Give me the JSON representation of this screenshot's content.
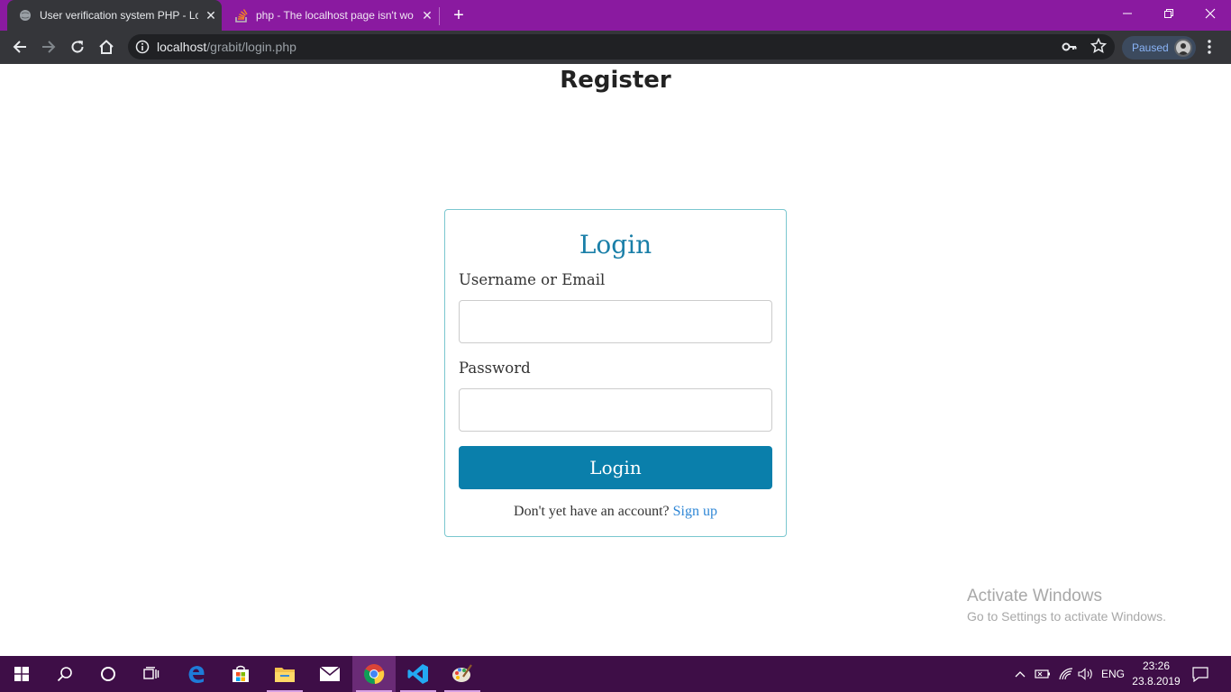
{
  "browser": {
    "tabs": [
      {
        "title": "User verification system PHP - Lo",
        "active": true
      },
      {
        "title": "php - The localhost page isn't wo",
        "active": false
      }
    ],
    "url_host": "localhost",
    "url_path": "/grabit/login.php",
    "profile_label": "Paused",
    "accent_color": "#8a1aa0"
  },
  "page": {
    "heading": "Register",
    "login_form": {
      "title": "Login",
      "username_label": "Username or Email",
      "username_value": "",
      "password_label": "Password",
      "password_value": "",
      "submit_label": "Login",
      "signup_prompt": "Don't yet have an account?",
      "signup_link": "Sign up",
      "primary_color": "#0a7fab"
    },
    "watermark": {
      "line1": "Activate Windows",
      "line2": "Go to Settings to activate Windows."
    }
  },
  "taskbar": {
    "apps": [
      "start-icon",
      "search-icon",
      "cortana-icon",
      "task-view-icon",
      "edge-icon",
      "store-icon",
      "file-explorer-icon",
      "mail-icon",
      "chrome-icon",
      "vscode-icon",
      "paint-icon"
    ],
    "language": "ENG",
    "time": "23:26",
    "date": "23.8.2019"
  }
}
